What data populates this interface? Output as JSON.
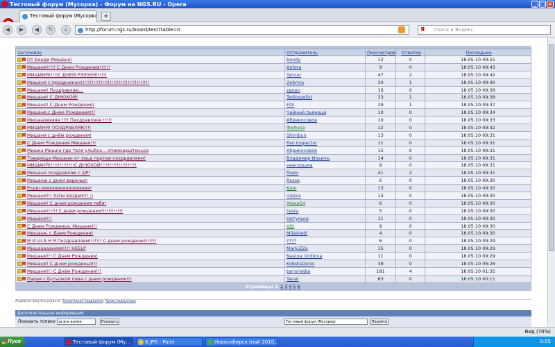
{
  "window": {
    "title": "Тестовый форум (Мусорка) - Форум на NGS.RU - Opera"
  },
  "tab": {
    "label": "Тестовый форум (Мусорка)"
  },
  "address": {
    "url": "http://forum.ngs.ru/board/test?table=0"
  },
  "search": {
    "provider": "Я",
    "placeholder": "Поиск в Яндекс"
  },
  "forum": {
    "headers": {
      "topic": "Заголовок",
      "author": "Отправитель",
      "views": "Просмотров",
      "replies": "Ответов",
      "last": "Последнее"
    },
    "rows": [
      {
        "topic": "От Бонди Мишане!",
        "author": "bondy",
        "views": "12",
        "replies": "0",
        "date": "18.05.10 09:51"
      },
      {
        "topic": "Мишаня!!!!! С Днем Рождения!!!!!!",
        "author": "Anfora",
        "views": "9",
        "replies": "0",
        "date": "18.05.10 09:43"
      },
      {
        "topic": "МИШАНЯ!!!!!С ДНЕМ РЭЭЭЭЭ!!!!!!",
        "author": "Tancer",
        "views": "47",
        "replies": "2",
        "date": "18.05.10 09:42"
      },
      {
        "topic": "Мишаня с праздником!!!!!!!!!!!!!!!!!!!!!!!!!!!!!!!!!!!!!!",
        "author": "Zebrina",
        "views": "30",
        "replies": "1",
        "date": "18.05.10 09:40"
      },
      {
        "topic": "Мишаня! Поздравляю...",
        "author": "zavan",
        "views": "16",
        "replies": "0",
        "date": "18.05.10 09:38"
      },
      {
        "topic": "Мишаня! С ДНЮХОЙ!",
        "author": "Tedioszelist",
        "views": "33",
        "replies": "1",
        "date": "18.05.10 09:38"
      },
      {
        "topic": "Мишаня! С Днем Рождения!",
        "author": "EDI",
        "views": "29",
        "replies": "1",
        "date": "18.05.10 09:37"
      },
      {
        "topic": "Мишаня,с Днем Рождения!!!",
        "author": "Чайный пьяница",
        "views": "10",
        "replies": "0",
        "date": "18.05.10 09:34"
      },
      {
        "topic": "Мишаняяяяяя !!!! Пахдравляяя !!!!!",
        "author": "Абрикосовое",
        "views": "10",
        "replies": "0",
        "date": "18.05.10 09:33"
      },
      {
        "topic": "МИШАНЯ! ПОЗДРАВЛЯЮ!!!",
        "author": "ФеАнеа",
        "views": "12",
        "replies": "0",
        "date": "18.05.10 09:32"
      },
      {
        "topic": "Мишаня с днём рождения!",
        "author": "Shimbun",
        "views": "13",
        "replies": "0",
        "date": "18.05.10 09:31"
      },
      {
        "topic": "С Днем Рождения Мишаня!!!",
        "author": "Pan Inspector",
        "views": "11",
        "replies": "0",
        "date": "18.05.10 09:31"
      },
      {
        "topic": "Мишка Мишка где твоя улыбка....спиемарштенька",
        "author": "Абрикосовое",
        "views": "15",
        "replies": "0",
        "date": "18.05.10 09:31"
      },
      {
        "topic": "Товарища Мишаню от лица партии поздравляем!",
        "author": "Владимир Ильичъ",
        "views": "14",
        "replies": "0",
        "date": "18.05.10 09:31"
      },
      {
        "topic": "МИШАНЯ!!!!!!!!!!!!!!С ДНЮХОЙ!!!!!!!!!!!!!!!!!!!!",
        "author": "неегрошка",
        "views": "9",
        "replies": "0",
        "date": "18.05.10 09:31"
      },
      {
        "topic": "Мишаня поздравляю с ДР!",
        "author": "flopic",
        "views": "41",
        "replies": "2",
        "date": "18.05.10 09:31"
      },
      {
        "topic": "Мишаню с днем варенья!",
        "author": "Rosse",
        "views": "6",
        "replies": "0",
        "date": "18.05.10 09:30"
      },
      {
        "topic": "Родисяяяяяяяяяяяяяяяяяя!",
        "author": "Kam",
        "views": "13",
        "replies": "0",
        "date": "18.05.10 09:30"
      },
      {
        "topic": "Мишаня!!! Хэпи Бёздэй!!! :)",
        "author": "irisska",
        "views": "13",
        "replies": "0",
        "date": "18.05.10 09:30"
      },
      {
        "topic": "Мишаня! С днем рождения тебя!",
        "author": "Жека54",
        "views": "6",
        "replies": "0",
        "date": "18.05.10 09:30"
      },
      {
        "topic": "Мишаня!!!!!! С днем рождения!!!!!!!!!!!!",
        "author": "teara",
        "views": "5",
        "replies": "0",
        "date": "18.05.10 09:30"
      },
      {
        "topic": "Мишаня!!!",
        "author": "Натуська",
        "views": "11",
        "replies": "0",
        "date": "18.05.10 09:30"
      },
      {
        "topic": "С Днем Рожденья, Мишаня!!!",
        "author": "Vitt",
        "views": "9",
        "replies": "0",
        "date": "18.05.10 09:30"
      },
      {
        "topic": "Мишаня, с Днем Рождения!",
        "author": "Milaisledi",
        "views": "4",
        "replies": "0",
        "date": "18.05.10 09:30"
      },
      {
        "topic": "М И Ш А Н Я Поздравляем!!!!!!! С днем рождения!!!!!!",
        "author": "????",
        "views": "6",
        "replies": "0",
        "date": "18.05.10 09:29"
      },
      {
        "topic": "Мишаааааняяя!!!! HEELP",
        "author": "MarkiZZa",
        "views": "15",
        "replies": "0",
        "date": "18.05.10 09:29"
      },
      {
        "topic": "Мишаня!!! С Днем Рождения!",
        "author": "Nastya_kirillova",
        "views": "11",
        "replies": "0",
        "date": "18.05.10 09:29"
      },
      {
        "topic": "Мишаня! С днем рожденья!!!",
        "author": "KobetsDenis",
        "views": "38",
        "replies": "0",
        "date": "18.05.10 06:26"
      },
      {
        "topic": "Мишаня!!! С Днём Рождения!!!",
        "author": "tarrorietka",
        "views": "181",
        "replies": "4",
        "date": "18.05.10 01:35"
      },
      {
        "topic": "Парня с Бутылкой пива с днем рождения!!!",
        "author": "Taran",
        "views": "63",
        "replies": "0",
        "date": "18.05.10 00:11"
      }
    ],
    "pager": {
      "label": "Страницы:",
      "current": "1",
      "pages": [
        "2",
        "3",
        "4",
        "5",
        "6"
      ]
    },
    "archive": {
      "label": "Архивные форумы раздела:",
      "link1": "Технические поддержка",
      "link2": "Архив модератора"
    },
    "info": {
      "title": "Дополнительная информация",
      "show_label": "Показать топики",
      "period_value": "за все время",
      "show_button": "Показать",
      "forum_value": "Тестовый форум (Мусорка)",
      "go_button": "Перейти"
    }
  },
  "statusbar": {
    "zoom": "Вид (70%)"
  },
  "taskbar": {
    "start": "Пуск",
    "tasks": [
      "Тестовый форум (Му...",
      "6.JPG - Paint",
      "Новосибирск (най 2010..."
    ],
    "clock": "9:55"
  },
  "colors": {
    "header_bg": "#c9d3e6",
    "row_odd": "#f2f3f8",
    "row_even": "#e4e7f0",
    "topic_link": "#7a0a3a",
    "author_link": "#1f3c8f"
  }
}
